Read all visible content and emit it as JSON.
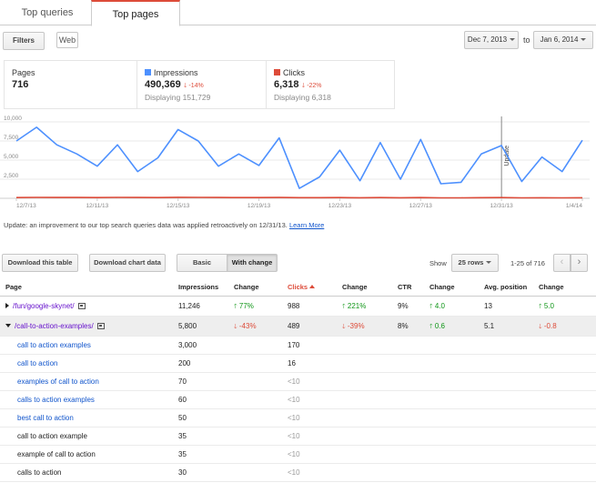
{
  "tabs": [
    {
      "label": "Top queries",
      "active": false
    },
    {
      "label": "Top pages",
      "active": true
    }
  ],
  "toolbar": {
    "filters_label": "Filters",
    "web_chip": "Web",
    "start_date": "Dec 7, 2013",
    "to_label": "to",
    "end_date": "Jan 6, 2014"
  },
  "summary": {
    "pages": {
      "label": "Pages",
      "value": "716"
    },
    "impressions": {
      "label": "Impressions",
      "value": "490,369",
      "change": "-14%",
      "displaying": "Displaying 151,729",
      "color": "#4d90fe"
    },
    "clicks": {
      "label": "Clicks",
      "value": "6,318",
      "change": "-22%",
      "displaying": "Displaying 6,318",
      "color": "#dd4b39"
    }
  },
  "chart_data": {
    "type": "line",
    "x": [
      "12/7/13",
      "12/8/13",
      "12/9/13",
      "12/10/13",
      "12/11/13",
      "12/12/13",
      "12/13/13",
      "12/14/13",
      "12/15/13",
      "12/16/13",
      "12/17/13",
      "12/18/13",
      "12/19/13",
      "12/20/13",
      "12/21/13",
      "12/22/13",
      "12/23/13",
      "12/24/13",
      "12/25/13",
      "12/26/13",
      "12/27/13",
      "12/28/13",
      "12/29/13",
      "12/30/13",
      "12/31/13",
      "1/1/14",
      "1/2/14",
      "1/3/14",
      "1/4/14"
    ],
    "x_tick_labels": [
      "12/7/13",
      "12/11/13",
      "12/15/13",
      "12/19/13",
      "12/23/13",
      "12/27/13",
      "12/31/13",
      "1/4/14"
    ],
    "series": [
      {
        "name": "Impressions",
        "color": "#4d90fe",
        "values": [
          7500,
          9300,
          7000,
          5800,
          4200,
          7000,
          3500,
          5300,
          9000,
          7500,
          4200,
          5800,
          4300,
          7900,
          1300,
          2800,
          6300,
          2300,
          7300,
          2500,
          7700,
          1900,
          2100,
          5800,
          6900,
          2200,
          5400,
          3500,
          7600
        ]
      },
      {
        "name": "Clicks",
        "color": "#dd4b39",
        "values": [
          100,
          120,
          110,
          110,
          100,
          120,
          110,
          100,
          130,
          120,
          110,
          100,
          90,
          110,
          80,
          80,
          100,
          70,
          90,
          70,
          90,
          60,
          60,
          80,
          90,
          60,
          70,
          60,
          70
        ]
      }
    ],
    "yticks": [
      "10,000",
      "7,500",
      "5,000",
      "2,500"
    ],
    "ylim": [
      0,
      10000
    ],
    "annotation": {
      "x": "12/31/13",
      "label": "Update"
    },
    "grid": true
  },
  "update_note": {
    "text": "Update: an improvement to our top search queries data was applied retroactively on 12/31/13.",
    "link": "Learn More"
  },
  "table_toolbar": {
    "download_table": "Download this table",
    "download_chart": "Download chart data",
    "basic": "Basic",
    "with_change": "With change",
    "show_label": "Show",
    "rows_select": "25 rows",
    "pager": "1-25 of 716",
    "prev": "‹",
    "next": "›"
  },
  "table": {
    "headers": [
      "Page",
      "Impressions",
      "Change",
      "Clicks",
      "Change",
      "CTR",
      "Change",
      "Avg. position",
      "Change"
    ],
    "rows": [
      {
        "page": "/fun/google-skynet/",
        "impressions": "11,246",
        "imp_change": "77%",
        "clicks": "988",
        "clk_change": "221%",
        "ctr": "9%",
        "ctr_change": "4.0",
        "pos": "13",
        "pos_change": "5.0"
      },
      {
        "page": "/call-to-action-examples/",
        "impressions": "5,800",
        "imp_change": "-43%",
        "clicks": "489",
        "clk_change": "-39%",
        "ctr": "8%",
        "ctr_change": "0.6",
        "pos": "5.1",
        "pos_change": "-0.8"
      }
    ],
    "children": [
      {
        "query": "call to action examples",
        "impressions": "3,000",
        "clicks": "170",
        "linked": true
      },
      {
        "query": "call to action",
        "impressions": "200",
        "clicks": "16",
        "linked": true
      },
      {
        "query": "examples of call to action",
        "impressions": "70",
        "clicks": "<10",
        "linked": true
      },
      {
        "query": "calls to action examples",
        "impressions": "60",
        "clicks": "<10",
        "linked": true
      },
      {
        "query": "best call to action",
        "impressions": "50",
        "clicks": "<10",
        "linked": true
      },
      {
        "query": "call to action example",
        "impressions": "35",
        "clicks": "<10",
        "linked": false
      },
      {
        "query": "example of call to action",
        "impressions": "35",
        "clicks": "<10",
        "linked": false
      },
      {
        "query": "calls to action",
        "impressions": "30",
        "clicks": "<10",
        "linked": false
      }
    ]
  }
}
